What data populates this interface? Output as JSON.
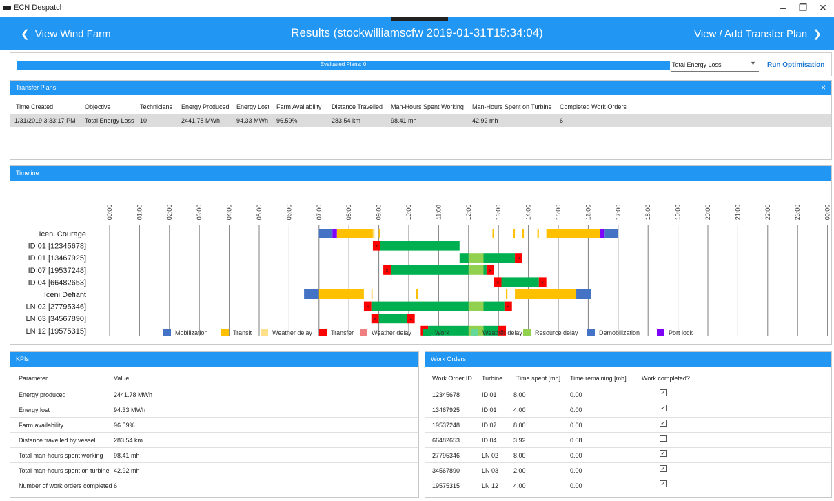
{
  "window": {
    "title": "ECN Despatch",
    "minimize": "–",
    "restore": "❐",
    "close": "✕"
  },
  "header": {
    "back_label": "View Wind Farm",
    "title": "Results (stockwilliamscfw 2019-01-31T15:34:04)",
    "forward_label": "View / Add Transfer Plan"
  },
  "optimisation": {
    "progress_label": "Evaluated Plans: 0",
    "progress_value": 1.0,
    "objective": "Total Energy Loss",
    "run_label": "Run Optimisation"
  },
  "transfer_plans": {
    "title": "Transfer Plans",
    "close": "×",
    "columns": [
      "Time Created",
      "Objective",
      "Technicians",
      "Energy Produced",
      "Energy Lost",
      "Farm Availability",
      "Distance Travelled",
      "Man-Hours Spent Working",
      "Man-Hours Spent on Turbine",
      "Completed Work Orders"
    ],
    "rows": [
      [
        "1/31/2019 3:33:17 PM",
        "Total Energy Loss",
        "10",
        "2441.78 MWh",
        "94.33 MWh",
        "96.59%",
        "283.54 km",
        "98.41 mh",
        "42.92 mh",
        "6"
      ]
    ]
  },
  "timeline": {
    "title": "Timeline"
  },
  "chart_data": {
    "type": "gantt",
    "hours": [
      "00:00",
      "01:00",
      "02:00",
      "03:00",
      "04:00",
      "05:00",
      "06:00",
      "07:00",
      "08:00",
      "09:00",
      "10:00",
      "11:00",
      "12:00",
      "13:00",
      "14:00",
      "15:00",
      "16:00",
      "17:00",
      "18:00",
      "19:00",
      "20:00",
      "21:00",
      "22:00",
      "23:00",
      "00:00"
    ],
    "rows": [
      "Iceni Courage",
      "ID 01 [12345678]",
      "ID 01 [13467925]",
      "ID 07 [19537248]",
      "ID 04 [66482653]",
      "Iceni Defiant",
      "LN 02 [27795346]",
      "LN 03 [34567890]",
      "LN 12 [19575315]"
    ],
    "categories": [
      {
        "name": "Mobilization",
        "color": "#4472c4"
      },
      {
        "name": "Transit",
        "color": "#ffc000"
      },
      {
        "name": "Weather delay",
        "color": "#ffe08a"
      },
      {
        "name": "Transfer",
        "color": "#ff0000"
      },
      {
        "name": "Weather delay",
        "color": "#f08080"
      },
      {
        "name": "Work",
        "color": "#00b050"
      },
      {
        "name": "Weather delay",
        "color": "#66d99a"
      },
      {
        "name": "Resource delay",
        "color": "#92d050"
      },
      {
        "name": "Demobilization",
        "color": "#4472c4"
      },
      {
        "name": "Port lock",
        "color": "#7f00ff"
      }
    ],
    "segments": [
      {
        "row": 0,
        "start": 7.0,
        "end": 7.45,
        "cat": 0
      },
      {
        "row": 0,
        "start": 7.45,
        "end": 7.6,
        "cat": 9
      },
      {
        "row": 0,
        "start": 7.6,
        "end": 8.8,
        "cat": 1
      },
      {
        "row": 0,
        "start": 8.8,
        "end": 8.86,
        "cat": 2
      },
      {
        "row": 0,
        "start": 9.0,
        "end": 9.05,
        "cat": 1
      },
      {
        "row": 0,
        "start": 12.8,
        "end": 12.85,
        "cat": 1
      },
      {
        "row": 0,
        "start": 13.5,
        "end": 13.55,
        "cat": 1
      },
      {
        "row": 0,
        "start": 13.8,
        "end": 13.85,
        "cat": 1
      },
      {
        "row": 0,
        "start": 14.3,
        "end": 14.35,
        "cat": 1
      },
      {
        "row": 0,
        "start": 14.6,
        "end": 16.4,
        "cat": 1
      },
      {
        "row": 0,
        "start": 16.4,
        "end": 16.55,
        "cat": 9
      },
      {
        "row": 0,
        "start": 16.55,
        "end": 17.0,
        "cat": 8
      },
      {
        "row": 1,
        "start": 8.8,
        "end": 9.05,
        "cat": 3
      },
      {
        "row": 1,
        "start": 9.05,
        "end": 11.7,
        "cat": 5
      },
      {
        "row": 2,
        "start": 11.7,
        "end": 12.0,
        "cat": 5
      },
      {
        "row": 2,
        "start": 12.0,
        "end": 12.5,
        "cat": 7
      },
      {
        "row": 2,
        "start": 12.5,
        "end": 13.55,
        "cat": 5
      },
      {
        "row": 2,
        "start": 13.55,
        "end": 13.8,
        "cat": 3
      },
      {
        "row": 3,
        "start": 9.15,
        "end": 9.4,
        "cat": 3
      },
      {
        "row": 3,
        "start": 9.4,
        "end": 12.0,
        "cat": 5
      },
      {
        "row": 3,
        "start": 12.0,
        "end": 12.5,
        "cat": 7
      },
      {
        "row": 3,
        "start": 12.5,
        "end": 12.6,
        "cat": 5
      },
      {
        "row": 3,
        "start": 12.6,
        "end": 12.85,
        "cat": 3
      },
      {
        "row": 4,
        "start": 12.85,
        "end": 13.1,
        "cat": 3
      },
      {
        "row": 4,
        "start": 13.1,
        "end": 14.35,
        "cat": 5
      },
      {
        "row": 4,
        "start": 14.35,
        "end": 14.6,
        "cat": 3
      },
      {
        "row": 5,
        "start": 6.5,
        "end": 7.0,
        "cat": 0
      },
      {
        "row": 5,
        "start": 7.0,
        "end": 8.5,
        "cat": 1
      },
      {
        "row": 5,
        "start": 8.75,
        "end": 8.8,
        "cat": 2
      },
      {
        "row": 5,
        "start": 10.25,
        "end": 10.3,
        "cat": 1
      },
      {
        "row": 5,
        "start": 13.25,
        "end": 13.3,
        "cat": 1
      },
      {
        "row": 5,
        "start": 13.55,
        "end": 15.6,
        "cat": 1
      },
      {
        "row": 5,
        "start": 15.6,
        "end": 16.1,
        "cat": 8
      },
      {
        "row": 6,
        "start": 8.5,
        "end": 8.75,
        "cat": 3
      },
      {
        "row": 6,
        "start": 8.75,
        "end": 12.0,
        "cat": 5
      },
      {
        "row": 6,
        "start": 12.0,
        "end": 12.5,
        "cat": 7
      },
      {
        "row": 6,
        "start": 12.5,
        "end": 13.2,
        "cat": 5
      },
      {
        "row": 6,
        "start": 13.2,
        "end": 13.45,
        "cat": 3
      },
      {
        "row": 7,
        "start": 8.75,
        "end": 9.0,
        "cat": 3
      },
      {
        "row": 7,
        "start": 9.0,
        "end": 9.95,
        "cat": 5
      },
      {
        "row": 7,
        "start": 9.95,
        "end": 10.2,
        "cat": 3
      },
      {
        "row": 8,
        "start": 10.4,
        "end": 10.65,
        "cat": 3
      },
      {
        "row": 8,
        "start": 10.65,
        "end": 12.0,
        "cat": 5
      },
      {
        "row": 8,
        "start": 12.0,
        "end": 12.5,
        "cat": 7
      },
      {
        "row": 8,
        "start": 12.5,
        "end": 13.0,
        "cat": 5
      },
      {
        "row": 8,
        "start": 13.0,
        "end": 13.25,
        "cat": 3
      }
    ]
  },
  "kpis": {
    "title": "KPIs",
    "columns": [
      "Parameter",
      "Value"
    ],
    "rows": [
      [
        "Energy produced",
        "2441.78 MWh"
      ],
      [
        "Energy lost",
        "94.33 MWh"
      ],
      [
        "Farm availability",
        "96.59%"
      ],
      [
        "Distance travelled by vessel",
        "283.54 km"
      ],
      [
        "Total man-hours spent working",
        "98.41 mh"
      ],
      [
        "Total man-hours spent on turbine",
        "42.92 mh"
      ],
      [
        "Number of work orders completed",
        "6"
      ]
    ]
  },
  "work_orders": {
    "title": "Work Orders",
    "columns": [
      "Work Order ID",
      "Turbine",
      "Time spent [mh]",
      "Time remaining [mh]",
      "Work completed?"
    ],
    "rows": [
      {
        "id": "12345678",
        "turbine": "ID 01",
        "spent": "8.00",
        "remaining": "0.00",
        "completed": true
      },
      {
        "id": "13467925",
        "turbine": "ID 01",
        "spent": "4.00",
        "remaining": "0.00",
        "completed": true
      },
      {
        "id": "19537248",
        "turbine": "ID 07",
        "spent": "8.00",
        "remaining": "0.00",
        "completed": true
      },
      {
        "id": "66482653",
        "turbine": "ID 04",
        "spent": "3.92",
        "remaining": "0.08",
        "completed": false
      },
      {
        "id": "27795346",
        "turbine": "LN 02",
        "spent": "8.00",
        "remaining": "0.00",
        "completed": true
      },
      {
        "id": "34567890",
        "turbine": "LN 03",
        "spent": "2.00",
        "remaining": "0.00",
        "completed": true
      },
      {
        "id": "19575315",
        "turbine": "LN 12",
        "spent": "4.00",
        "remaining": "0.00",
        "completed": true
      }
    ],
    "check_mark": "✓"
  }
}
